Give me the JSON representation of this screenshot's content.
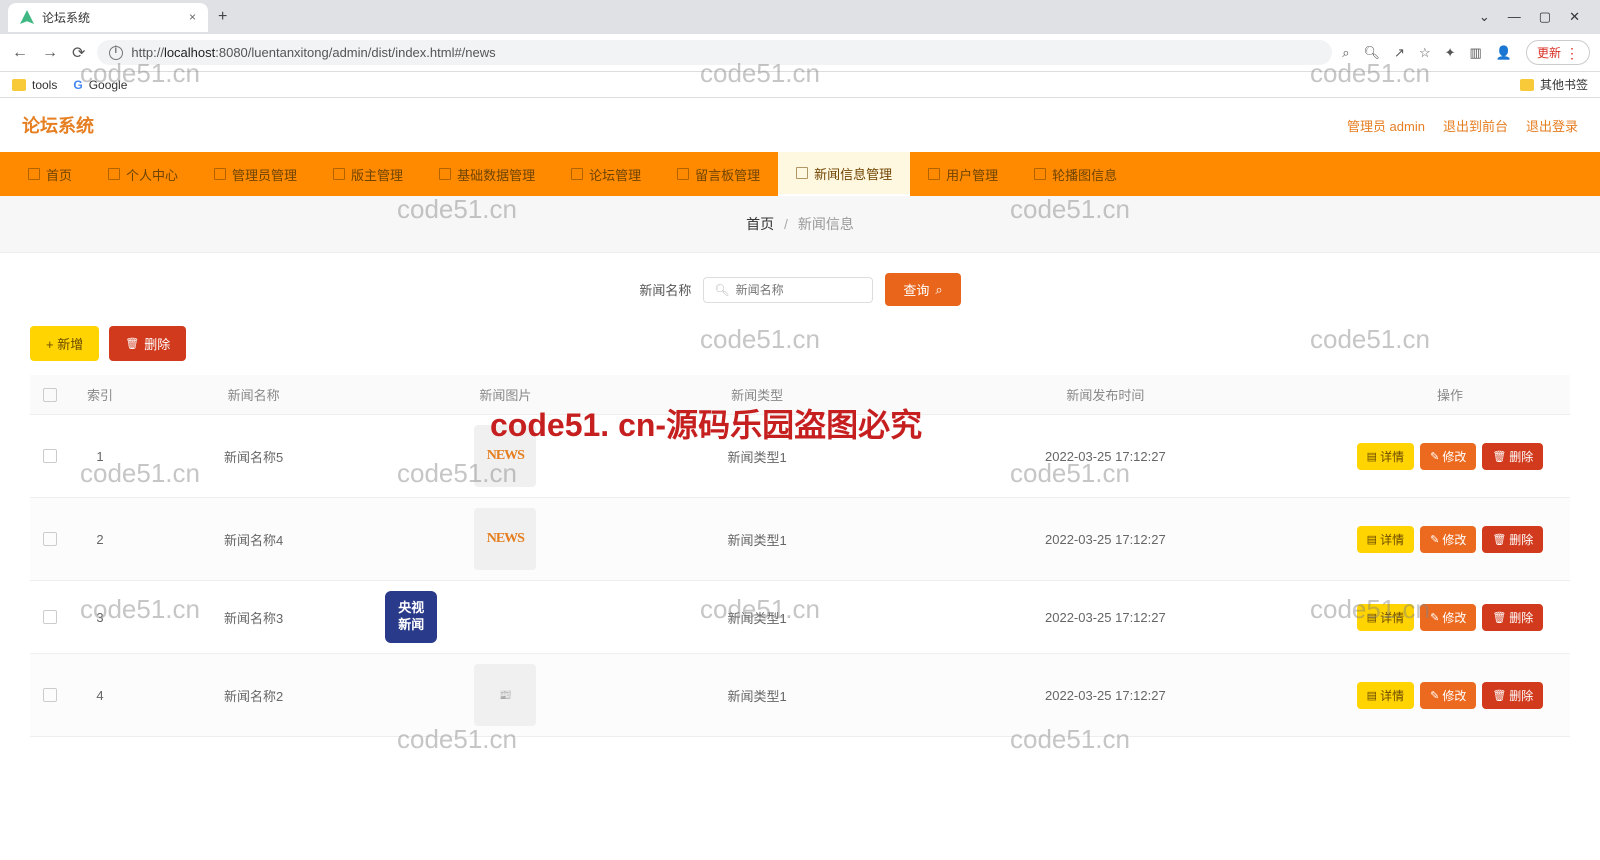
{
  "browser": {
    "tab_title": "论坛系统",
    "url_prefix": "http://",
    "url_host": "localhost",
    "url_path": ":8080/luentanxitong/admin/dist/index.html#/news",
    "update_label": "更新",
    "bookmarks": {
      "tools": "tools",
      "google": "Google",
      "other": "其他书签"
    }
  },
  "header": {
    "title": "论坛系统",
    "user_role": "管理员 admin",
    "to_front": "退出到前台",
    "logout": "退出登录"
  },
  "nav": {
    "items": [
      {
        "label": "首页"
      },
      {
        "label": "个人中心"
      },
      {
        "label": "管理员管理"
      },
      {
        "label": "版主管理"
      },
      {
        "label": "基础数据管理"
      },
      {
        "label": "论坛管理"
      },
      {
        "label": "留言板管理"
      },
      {
        "label": "新闻信息管理",
        "active": true
      },
      {
        "label": "用户管理"
      },
      {
        "label": "轮播图信息"
      }
    ]
  },
  "breadcrumb": {
    "home": "首页",
    "current": "新闻信息"
  },
  "search": {
    "label": "新闻名称",
    "placeholder": "新闻名称",
    "button": "查询"
  },
  "actions": {
    "add": "新增",
    "delete": "删除"
  },
  "table": {
    "headers": {
      "index": "索引",
      "name": "新闻名称",
      "image": "新闻图片",
      "type": "新闻类型",
      "published": "新闻发布时间",
      "ops": "操作"
    },
    "rows": [
      {
        "idx": "1",
        "name": "新闻名称5",
        "img": "news",
        "type": "新闻类型1",
        "published": "2022-03-25 17:12:27"
      },
      {
        "idx": "2",
        "name": "新闻名称4",
        "img": "news",
        "type": "新闻类型1",
        "published": "2022-03-25 17:12:27"
      },
      {
        "idx": "3",
        "name": "新闻名称3",
        "img": "cctv",
        "type": "新闻类型1",
        "published": "2022-03-25 17:12:27"
      },
      {
        "idx": "4",
        "name": "新闻名称2",
        "img": "doc",
        "type": "新闻类型1",
        "published": "2022-03-25 17:12:27"
      }
    ],
    "ops": {
      "detail": "详情",
      "edit": "修改",
      "delete": "删除"
    },
    "cctv": {
      "l1": "央视",
      "l2": "新闻"
    }
  },
  "watermark": {
    "small": "code51.cn",
    "big": "code51. cn-源码乐园盗图必究"
  }
}
